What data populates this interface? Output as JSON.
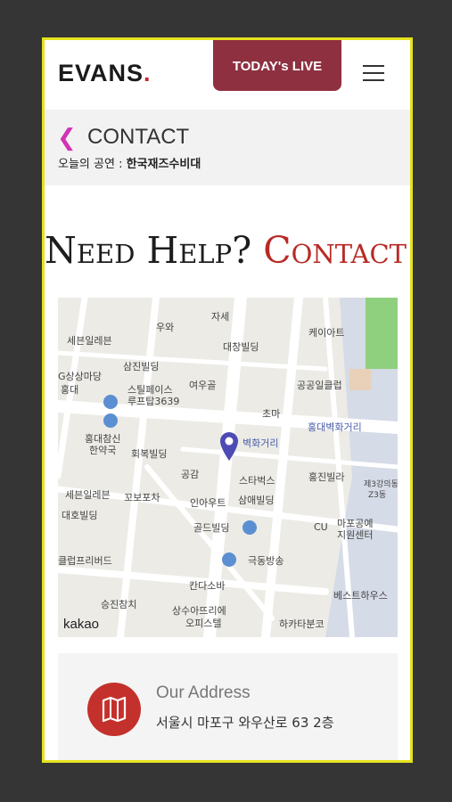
{
  "header": {
    "logo_text": "EVANS",
    "logo_dot": ".",
    "live_button": "TODAY's LIVE",
    "menu_icon": "hamburger-icon"
  },
  "subbar": {
    "back_icon": "chevron-left-icon",
    "title": "CONTACT",
    "show_label": "오늘의 공연 : ",
    "show_name": "한국재즈수비대"
  },
  "headline": {
    "part1": "Need Help? ",
    "part2": "Contact Us"
  },
  "map": {
    "attribution": "kakao",
    "labels": [
      "세븐일레븐",
      "우와",
      "자세",
      "삼진빌딩",
      "대창빌딩",
      "케이아트",
      "G상상마당",
      "홍대",
      "스틸페이스",
      "루프탑3639",
      "여우골",
      "공공일클럽",
      "초마",
      "홍대벽화거리",
      "홍대참신",
      "한약국",
      "회복빌딩",
      "벽화거리",
      "공감",
      "스타벅스",
      "홍진빌라",
      "삼애빌딩",
      "세븐일레븐",
      "꼬보포차",
      "인아우트",
      "대호빌딩",
      "골드빌딩",
      "CU",
      "마포공예",
      "지원센터",
      "클럽프리버드",
      "극동방송",
      "칸다소바",
      "베스트하우스",
      "승진참치",
      "상수아뜨리에",
      "오피스텔",
      "하카타분코",
      "제3강의동",
      "Z3동"
    ]
  },
  "address": {
    "icon": "map-icon",
    "title": "Our Address",
    "text": "서울시 마포구 와우산로 63 2층"
  },
  "colors": {
    "accent_red": "#b82a25",
    "live_button": "#8e3040",
    "back_icon": "#d233b4",
    "frame_border": "#e6e21f"
  }
}
